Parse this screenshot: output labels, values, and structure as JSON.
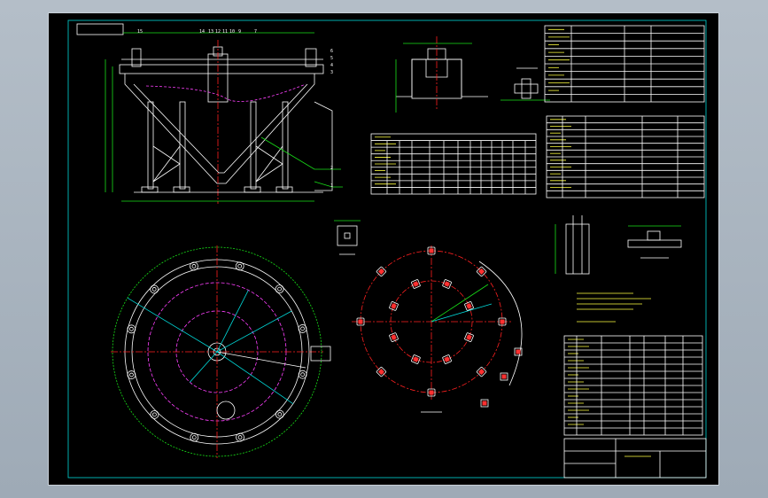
{
  "colors": {
    "background": "#000000",
    "frame": "#00d8d8",
    "outline": "#ffffff",
    "dimension": "#18e018",
    "centerline": "#ff2020",
    "hidden": "#ff40ff",
    "text": "#ffff40"
  },
  "callouts": [
    "15",
    "14",
    "13",
    "12",
    "11",
    "10",
    "9",
    "7",
    "6",
    "5",
    "4",
    "3",
    "2",
    "1"
  ],
  "legs": 4,
  "bolt_circle": {
    "bolts": 16,
    "rings": 2
  },
  "plan_view": {
    "legs": 12
  }
}
